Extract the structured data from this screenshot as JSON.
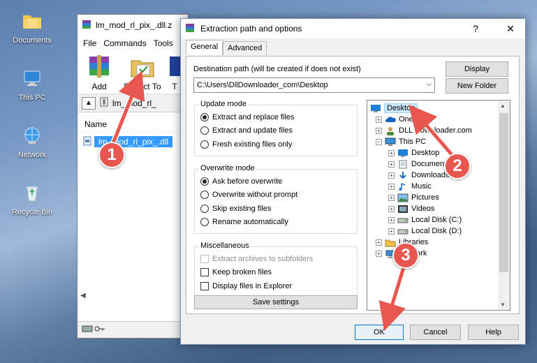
{
  "desktop": {
    "icons": [
      {
        "label": "Documents",
        "icon": "folder-icon"
      },
      {
        "label": "This PC",
        "icon": "computer-icon"
      },
      {
        "label": "Network",
        "icon": "network-icon"
      },
      {
        "label": "Recycle Bin",
        "icon": "recycle-bin-icon"
      }
    ]
  },
  "winrar": {
    "title": "lm_mod_rl_pix_.dll.z",
    "menu": [
      "File",
      "Commands",
      "Tools"
    ],
    "toolbar": {
      "add_label": "Add",
      "extract_label": "Extract To",
      "third_label": "T"
    },
    "address": "lm_mod_rl_",
    "column_name": "Name",
    "file_name": "lm_mod_rl_pix_.dll"
  },
  "dialog": {
    "title": "Extraction path and options",
    "help_glyph": "?",
    "close_glyph": "✕",
    "tabs": [
      "General",
      "Advanced"
    ],
    "destination_label": "Destination path (will be created if does not exist)",
    "destination_value": "C:\\Users\\DllDownloader_com\\Desktop",
    "display_button": "Display",
    "new_folder_button": "New Folder",
    "update_mode": {
      "title": "Update mode",
      "options": [
        "Extract and replace files",
        "Extract and update files",
        "Fresh existing files only"
      ],
      "selected": 0
    },
    "overwrite_mode": {
      "title": "Overwrite mode",
      "options": [
        "Ask before overwrite",
        "Overwrite without prompt",
        "Skip existing files",
        "Rename automatically"
      ],
      "selected": 0
    },
    "misc": {
      "title": "Miscellaneous",
      "options": [
        "Extract archives to subfolders",
        "Keep broken files",
        "Display files in Explorer"
      ]
    },
    "save_settings": "Save settings",
    "tree": [
      {
        "label": "Desktop",
        "level": 0,
        "expander": "",
        "icon": "desktop-icon",
        "selected": true
      },
      {
        "label": "OneDrive",
        "level": 1,
        "expander": "+",
        "icon": "onedrive-icon"
      },
      {
        "label": "DLL Downloader.com",
        "level": 1,
        "expander": "+",
        "icon": "user-icon"
      },
      {
        "label": "This PC",
        "level": 1,
        "expander": "−",
        "icon": "computer-icon"
      },
      {
        "label": "Desktop",
        "level": 2,
        "expander": "+",
        "icon": "desktop-icon"
      },
      {
        "label": "Documents",
        "level": 2,
        "expander": "+",
        "icon": "documents-icon"
      },
      {
        "label": "Downloads",
        "level": 2,
        "expander": "+",
        "icon": "downloads-icon"
      },
      {
        "label": "Music",
        "level": 2,
        "expander": "+",
        "icon": "music-icon"
      },
      {
        "label": "Pictures",
        "level": 2,
        "expander": "+",
        "icon": "pictures-icon"
      },
      {
        "label": "Videos",
        "level": 2,
        "expander": "+",
        "icon": "videos-icon"
      },
      {
        "label": "Local Disk (C:)",
        "level": 2,
        "expander": "+",
        "icon": "disk-icon"
      },
      {
        "label": "Local Disk (D:)",
        "level": 2,
        "expander": "+",
        "icon": "disk-icon"
      },
      {
        "label": "Libraries",
        "level": 1,
        "expander": "+",
        "icon": "libraries-icon"
      },
      {
        "label": "Network",
        "level": 1,
        "expander": "+",
        "icon": "network-icon"
      }
    ],
    "ok_button": "OK",
    "cancel_button": "Cancel",
    "help_button": "Help"
  },
  "callouts": [
    "1",
    "2",
    "3"
  ],
  "colors": {
    "callout": "#e8574f",
    "selection": "#3399ff",
    "ok_border": "#0078d7"
  }
}
